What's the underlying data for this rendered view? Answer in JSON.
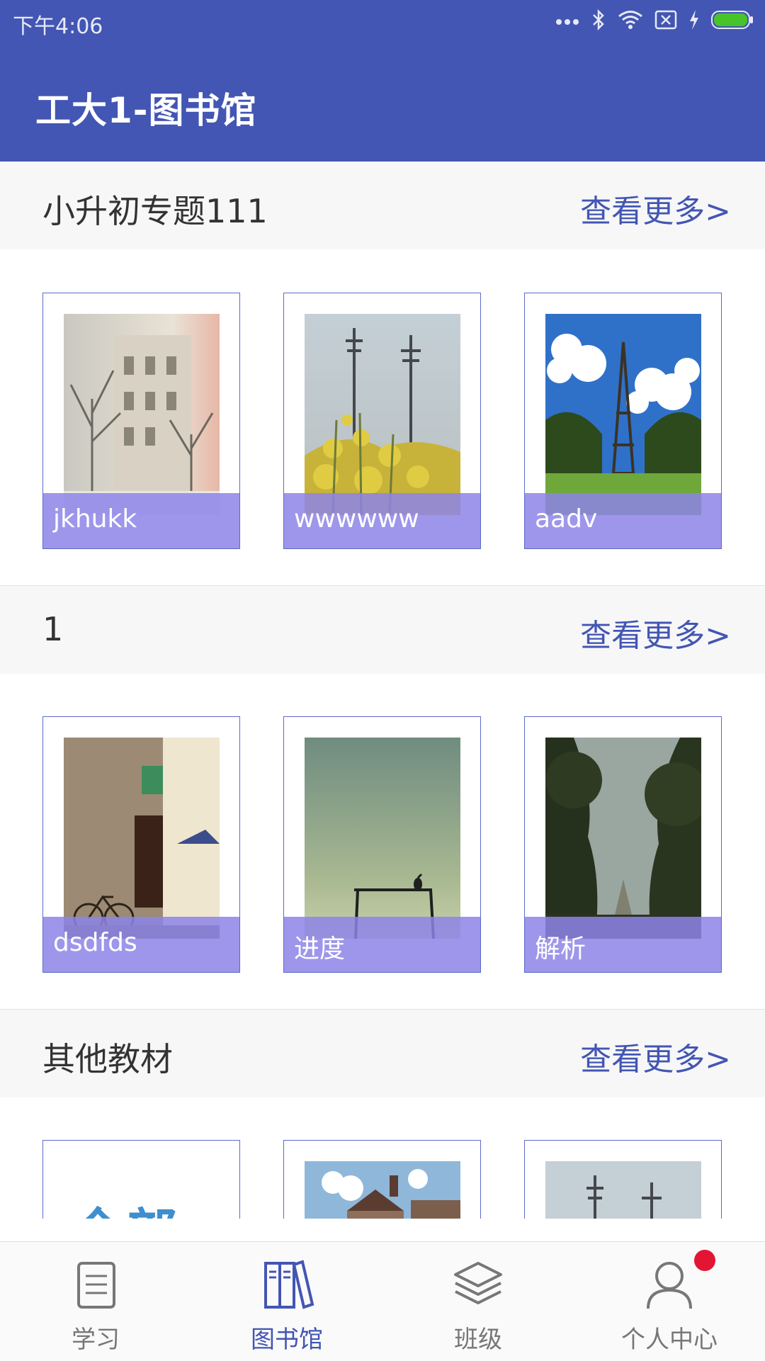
{
  "status_bar": {
    "time": "下午4:06"
  },
  "app_bar": {
    "title": "工大1-图书馆"
  },
  "sections": [
    {
      "title": "小升初专题111",
      "more": "查看更多>",
      "items": [
        {
          "label": "jkhukk",
          "image": "snowy-street-photo"
        },
        {
          "label": "wwwwww",
          "image": "rapeseed-powerlines-photo"
        },
        {
          "label": "aadv",
          "image": "eiffel-tower-photo"
        }
      ]
    },
    {
      "title": "1",
      "more": "查看更多>",
      "items": [
        {
          "label": "dsdfds",
          "image": "old-building-bicycle-photo"
        },
        {
          "label": "进度",
          "image": "bird-on-swing-photo"
        },
        {
          "label": "解析",
          "image": "forest-path-photo"
        }
      ]
    },
    {
      "title": "其他教材",
      "more": "查看更多>",
      "items": [
        {
          "label": "",
          "image": "all-text-cover",
          "cover_text": "全部"
        },
        {
          "label": "",
          "image": "houses-sky-photo"
        },
        {
          "label": "",
          "image": "powerlines-photo"
        }
      ]
    }
  ],
  "bottom_nav": {
    "items": [
      {
        "label": "学习",
        "icon": "document-icon"
      },
      {
        "label": "图书馆",
        "icon": "books-icon",
        "active": true
      },
      {
        "label": "班级",
        "icon": "layers-icon"
      },
      {
        "label": "个人中心",
        "icon": "person-icon",
        "badge": true
      }
    ]
  },
  "colors": {
    "primary": "#4356b3",
    "label_overlay": "#8d84e8",
    "badge": "#e41433"
  }
}
